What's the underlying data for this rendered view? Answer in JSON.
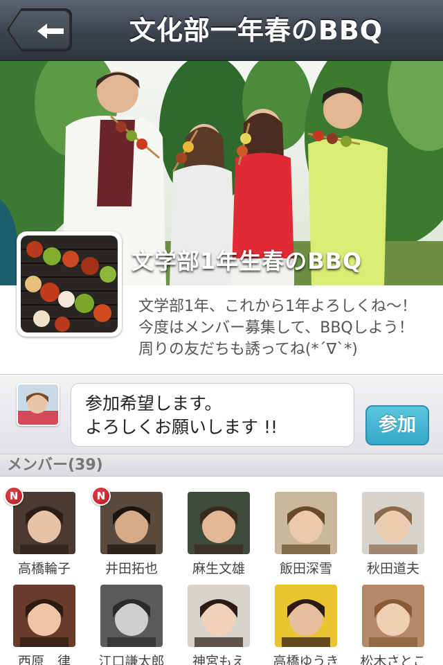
{
  "navbar": {
    "title": "文化部一年春のBBQ",
    "back_icon": "back-arrow-icon"
  },
  "event": {
    "name": "文学部1年生春のBBQ",
    "description": "文学部1年、これから1年よろしくね〜！\n今度はメンバー募集して、BBQしよう！\n周りの友だちも誘ってね(*´∇`*)"
  },
  "comment": {
    "text": "参加希望します。\nよろしくお願いします !!",
    "join_label": "参加"
  },
  "members": {
    "header": "メンバー(39)",
    "badge_label": "N",
    "list": [
      {
        "name": "高橋輪子",
        "new": true
      },
      {
        "name": "井田拓也",
        "new": true
      },
      {
        "name": "麻生文雄",
        "new": false
      },
      {
        "name": "飯田深雪",
        "new": false
      },
      {
        "name": "秋田道夫",
        "new": false
      },
      {
        "name": "西原　律",
        "new": false
      },
      {
        "name": "江口謙太郎",
        "new": false
      },
      {
        "name": "神宮もえ",
        "new": false
      },
      {
        "name": "高橋ゆうき",
        "new": false
      },
      {
        "name": "松木さとこ",
        "new": false
      }
    ]
  },
  "colors": {
    "navbar": "#3c434d",
    "accent": "#35a8c6",
    "badge": "#d0252d"
  }
}
